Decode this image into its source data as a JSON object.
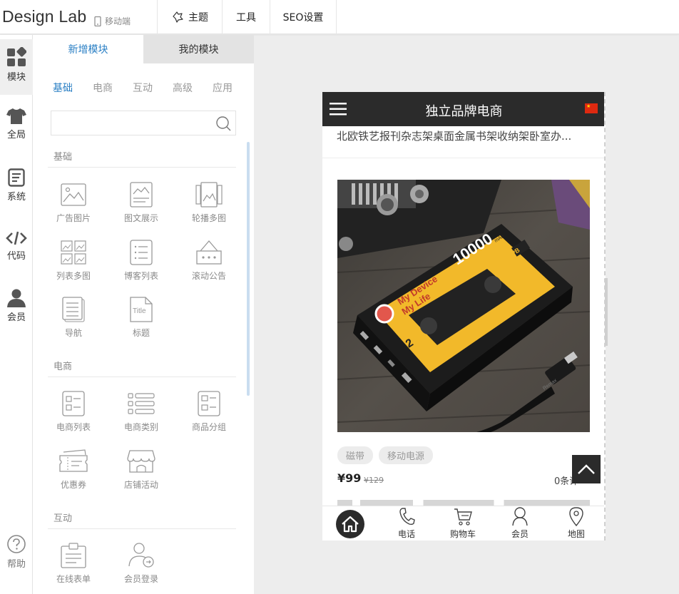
{
  "app": {
    "logo": "Design Lab",
    "mode_label": "移动端"
  },
  "topmenu": [
    {
      "label": "主题",
      "icon": "theme-icon"
    },
    {
      "label": "工具",
      "icon": ""
    },
    {
      "label": "SEO设置",
      "icon": ""
    }
  ],
  "rail": [
    {
      "label": "模块",
      "icon": "modules-icon"
    },
    {
      "label": "全局",
      "icon": "shirt-icon"
    },
    {
      "label": "系统",
      "icon": "document-icon"
    },
    {
      "label": "代码",
      "icon": "code-icon"
    },
    {
      "label": "会员",
      "icon": "user-icon"
    },
    {
      "label": "帮助",
      "icon": "help-icon"
    }
  ],
  "panel": {
    "tabs": [
      "新增模块",
      "我的模块"
    ],
    "subtabs": [
      "基础",
      "电商",
      "互动",
      "高级",
      "应用"
    ],
    "search_placeholder": "",
    "sections": [
      {
        "title": "基础",
        "modules": [
          "广告图片",
          "图文展示",
          "轮播多图",
          "列表多图",
          "博客列表",
          "滚动公告",
          "导航",
          "标题"
        ]
      },
      {
        "title": "电商",
        "modules": [
          "电商列表",
          "电商类别",
          "商品分组",
          "优惠券",
          "店铺活动"
        ]
      },
      {
        "title": "互动",
        "modules": [
          "在线表单",
          "会员登录"
        ]
      }
    ]
  },
  "preview": {
    "header_title": "独立品牌电商",
    "prev_product_title": "北欧铁艺报刊杂志架桌面金属书架收纳架卧室办...",
    "product_image_text": {
      "brand_line1": "My Device",
      "brand_line2": "My Life",
      "capacity": "10000",
      "unit": "mAh",
      "badge": "PB",
      "cable_brand": "Remax"
    },
    "tags": [
      "磁带",
      "移动电源"
    ],
    "price": "¥99",
    "old_price": "¥129",
    "comments": "0条评论",
    "bottom_nav": [
      {
        "label": "",
        "icon": "home-icon"
      },
      {
        "label": "电话",
        "icon": "phone-icon"
      },
      {
        "label": "购物车",
        "icon": "cart-icon"
      },
      {
        "label": "会员",
        "icon": "member-icon"
      },
      {
        "label": "地图",
        "icon": "map-pin-icon"
      }
    ]
  },
  "colors": {
    "accent": "#2a7fc4",
    "phone_header": "#2b2b2b",
    "product_yellow": "#f2b92a"
  }
}
